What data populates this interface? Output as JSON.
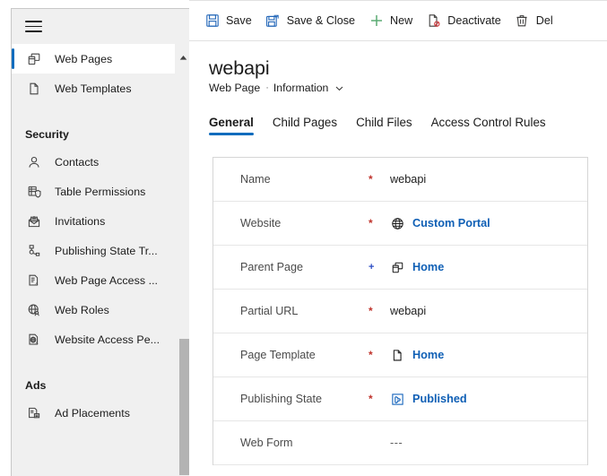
{
  "sidebar": {
    "menu_icon": "hamburger-icon",
    "scroll_up_icon": "chevron-up-icon",
    "items": [
      {
        "type": "item",
        "label": "Web Pages",
        "icon": "web-pages-icon",
        "selected": true
      },
      {
        "type": "item",
        "label": "Web Templates",
        "icon": "web-templates-icon",
        "selected": false
      },
      {
        "type": "group",
        "label": "Security"
      },
      {
        "type": "item",
        "label": "Contacts",
        "icon": "contact-icon",
        "selected": false
      },
      {
        "type": "item",
        "label": "Table  Permissions",
        "icon": "table-permissions-icon",
        "selected": false
      },
      {
        "type": "item",
        "label": "Invitations",
        "icon": "invitations-icon",
        "selected": false
      },
      {
        "type": "item",
        "label": "Publishing State Tr...",
        "icon": "publishing-state-transition-icon",
        "selected": false
      },
      {
        "type": "item",
        "label": "Web Page Access ...",
        "icon": "web-page-access-icon",
        "selected": false
      },
      {
        "type": "item",
        "label": "Web Roles",
        "icon": "web-roles-icon",
        "selected": false
      },
      {
        "type": "item",
        "label": "Website Access Pe...",
        "icon": "website-access-permission-icon",
        "selected": false
      },
      {
        "type": "group",
        "label": "Ads"
      },
      {
        "type": "item",
        "label": "Ad Placements",
        "icon": "ad-placements-icon",
        "selected": false
      }
    ]
  },
  "commandbar": {
    "buttons": [
      {
        "label": "Save",
        "icon": "save-icon"
      },
      {
        "label": "Save & Close",
        "icon": "save-and-close-icon"
      },
      {
        "label": "New",
        "icon": "plus-icon"
      },
      {
        "label": "Deactivate",
        "icon": "deactivate-icon"
      },
      {
        "label": "Del",
        "icon": "delete-trash-icon"
      }
    ]
  },
  "header": {
    "title": "webapi",
    "entity": "Web Page",
    "separator": "·",
    "form_name": "Information",
    "chevron_icon": "chevron-down-icon"
  },
  "tabs": [
    {
      "label": "General",
      "active": true
    },
    {
      "label": "Child Pages",
      "active": false
    },
    {
      "label": "Child Files",
      "active": false
    },
    {
      "label": "Access Control Rules",
      "active": false
    }
  ],
  "form": {
    "rows": [
      {
        "label": "Name",
        "required": "*",
        "required_kind": "star",
        "value": "webapi",
        "link": false,
        "icon": null
      },
      {
        "label": "Website",
        "required": "*",
        "required_kind": "star",
        "value": "Custom Portal",
        "link": true,
        "icon": "globe-icon"
      },
      {
        "label": "Parent Page",
        "required": "+",
        "required_kind": "plus",
        "value": "Home",
        "link": true,
        "icon": "web-pages-icon"
      },
      {
        "label": "Partial URL",
        "required": "*",
        "required_kind": "star",
        "value": "webapi",
        "link": false,
        "icon": null
      },
      {
        "label": "Page Template",
        "required": "*",
        "required_kind": "star",
        "value": "Home",
        "link": true,
        "icon": "web-templates-icon"
      },
      {
        "label": "Publishing State",
        "required": "*",
        "required_kind": "star",
        "value": "Published",
        "link": true,
        "icon": "publishing-state-icon"
      },
      {
        "label": "Web Form",
        "required": "",
        "required_kind": "none",
        "value": "---",
        "link": false,
        "icon": null
      }
    ]
  },
  "colors": {
    "accent": "#0f6cbd",
    "link": "#0f5fb5",
    "required": "#c0342c",
    "optional_plus": "#2b4cc4",
    "new_green": "#5aaa72",
    "sidebar_bg": "#f0f0f0"
  }
}
